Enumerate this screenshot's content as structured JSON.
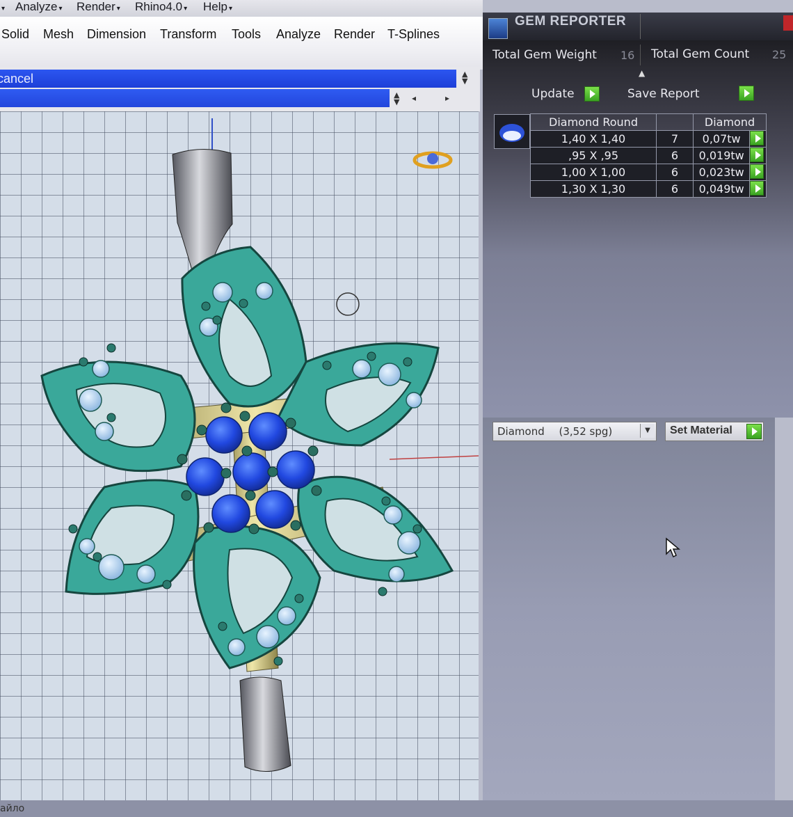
{
  "menubar_top": {
    "items": [
      {
        "label": "Analyze"
      },
      {
        "label": "Render"
      },
      {
        "label": "Rhino4.0"
      },
      {
        "label": "Help"
      }
    ]
  },
  "menubar_main": {
    "items": [
      {
        "label": "Solid"
      },
      {
        "label": "Mesh"
      },
      {
        "label": "Dimension"
      },
      {
        "label": "Transform"
      },
      {
        "label": "Tools"
      },
      {
        "label": "Analyze"
      },
      {
        "label": "Render"
      },
      {
        "label": "T-Splines"
      }
    ]
  },
  "command": {
    "prompt": "cancel"
  },
  "gem_reporter": {
    "title": "GEM REPORTER",
    "total_weight_label": "Total Gem Weight",
    "total_weight_value": "16",
    "total_count_label": "Total Gem Count",
    "total_count_value": "25",
    "update_label": "Update",
    "save_report_label": "Save Report",
    "table": {
      "headers": [
        "Diamond Round",
        "",
        "Diamond"
      ],
      "rows": [
        {
          "size": "1,40 X 1,40",
          "count": "7",
          "weight": "0,07tw"
        },
        {
          "size": ",95 X ,95",
          "count": "6",
          "weight": "0,019tw"
        },
        {
          "size": "1,00 X 1,00",
          "count": "6",
          "weight": "0,023tw"
        },
        {
          "size": "1,30 X 1,30",
          "count": "6",
          "weight": "0,049tw"
        }
      ]
    }
  },
  "material": {
    "selected": "Diamond",
    "selected_detail": "(3,52 spg)",
    "set_button_label": "Set Material"
  },
  "footer": {
    "text": "айло"
  },
  "colors": {
    "accent_blue": "#2246dc",
    "model_teal": "#3aa89a",
    "gem_blue": "#2f5ae8",
    "play_green": "#4cc02c",
    "panel_dark": "#1e1f26"
  },
  "icons": {
    "gem_logo": "gem-reporter-logo-icon",
    "play": "green-play-arrow-icon",
    "diamond": "round-diamond-icon",
    "cursor": "mouse-pointer-icon",
    "gumball": "rotate-gizmo-icon"
  }
}
